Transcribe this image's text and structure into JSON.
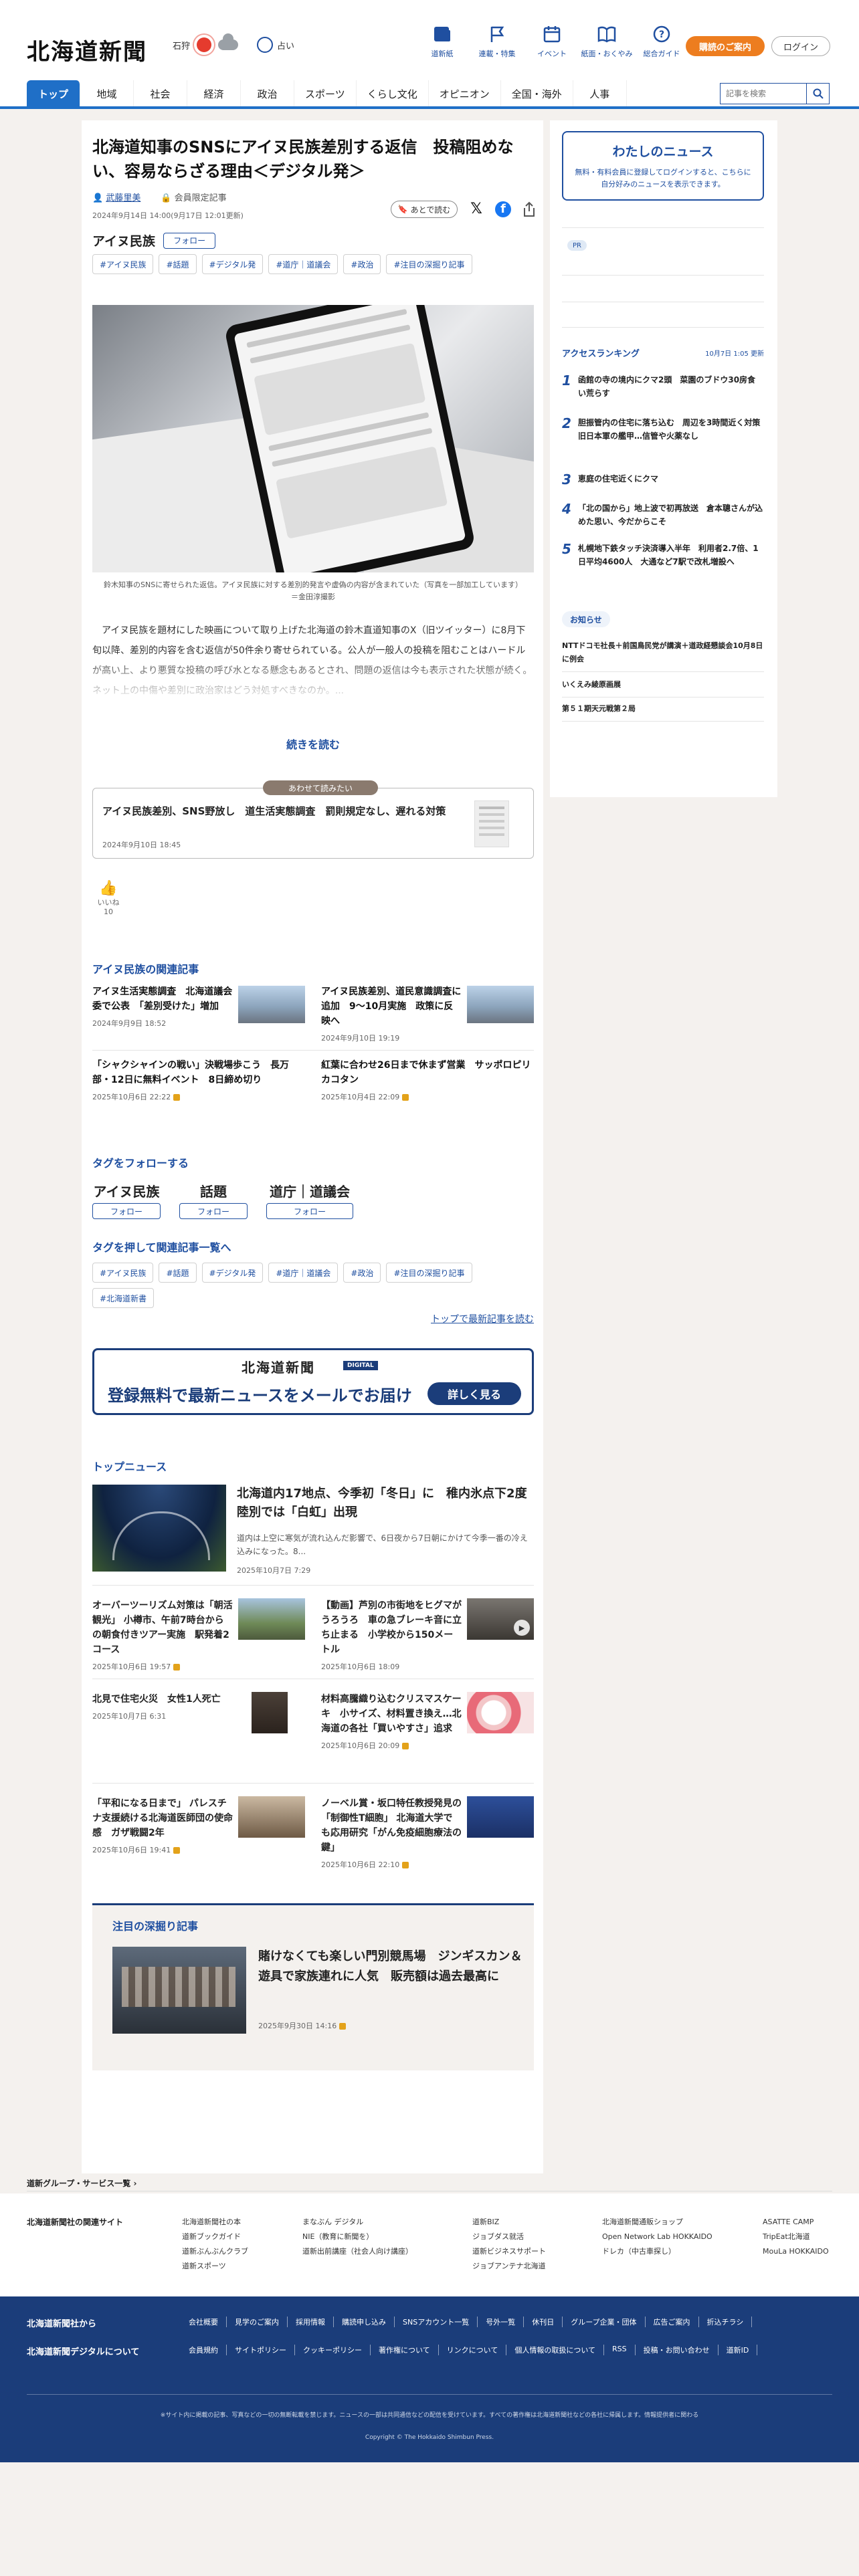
{
  "header": {
    "logo": "北海道新聞",
    "weather_city": "石狩",
    "fortune": "占い",
    "nav": [
      {
        "label": "道新紙",
        "icon": "newspaper-icon"
      },
      {
        "label": "連載・特集",
        "icon": "flag-icon"
      },
      {
        "label": "イベント",
        "icon": "calendar-icon"
      },
      {
        "label": "紙面・おくやみ",
        "icon": "book-icon"
      },
      {
        "label": "総合ガイド",
        "icon": "question-icon"
      }
    ],
    "guide_button": "購読のご案内",
    "login_button": "ログイン",
    "menu": [
      "トップ",
      "地域",
      "社会",
      "経済",
      "政治",
      "スポーツ",
      "くらし文化",
      "オピニオン",
      "全国・海外",
      "人事"
    ],
    "search_placeholder": "記事を検索"
  },
  "article": {
    "title": "北海道知事のSNSにアイヌ民族差別する返信　投稿阻めない、容易ならざる理由＜デジタル発＞",
    "author": "武藤里美",
    "member_label": "会員限定記事",
    "dates": "2024年9月14日 14:00(9月17日 12:01更新)",
    "later_button": "あとで読む",
    "topic": "アイヌ民族",
    "follow": "フォロー",
    "tags": [
      "#アイヌ民族",
      "#話題",
      "#デジタル発",
      "#道庁｜道議会",
      "#政治",
      "#注目の深掘り記事"
    ],
    "caption": "鈴木知事のSNSに寄せられた返信。アイヌ民族に対する差別的発言や虚偽の内容が含まれていた（写真を一部加工しています）＝金田淳撮影",
    "body": "アイヌ民族を題材にした映画について取り上げた北海道の鈴木直道知事のX（旧ツイッター）に8月下旬以降、差別的内容を含む返信が50件余り寄せられている。公人が一般人の投稿を阻むことはハードルが高い上、より悪質な投稿の呼び水となる懸念もあるとされ、問題の返信は今も表示された状態が続く。ネット上の中傷や差別に政治家はどう対処すべきなのか。...",
    "read_more": "続きを読む",
    "also_label": "あわせて読みたい",
    "also_title": "アイヌ民族差別、SNS野放し　道生活実態調査　罰則規定なし、遅れる対策",
    "also_date": "2024年9月10日 18:45",
    "like_label": "いいね",
    "like_count": "10"
  },
  "related": {
    "title": "アイヌ民族の関連記事",
    "items": [
      {
        "title": "アイヌ生活実態調査　北海道議会委で公表　「差別受けた」増加",
        "date": "2024年9月9日 18:52",
        "locked": false
      },
      {
        "title": "アイヌ民族差別、道民意識調査に追加　9～10月実施　政策に反映へ",
        "date": "2024年9月10日 19:19",
        "locked": false
      },
      {
        "title": "「シャクシャインの戦い」決戦場歩こう　長万部・12日に無料イベント　8日締め切り",
        "date": "2025年10月6日 22:22",
        "locked": true
      },
      {
        "title": "紅葉に合わせ26日まで休まず営業　サッポロピリカコタン",
        "date": "2025年10月4日 22:09",
        "locked": true
      }
    ]
  },
  "tag_follow": {
    "title": "タグをフォローする",
    "items": [
      "アイヌ民族",
      "話題",
      "道庁｜道議会"
    ],
    "button": "フォロー"
  },
  "tag_list": {
    "title": "タグを押して関連記事一覧へ",
    "tags": [
      "#アイヌ民族",
      "#話題",
      "#デジタル発",
      "#道庁｜道議会",
      "#政治",
      "#注目の深掘り記事",
      "#北海道新書"
    ],
    "latest_link": "トップで最新記事を読む"
  },
  "banner": {
    "logo": "北海道新聞",
    "digital": "DIGITAL",
    "text": "登録無料で最新ニュースをメールでお届け",
    "button": "詳しく見る"
  },
  "top_news": {
    "title": "トップニュース",
    "hero": {
      "title": "北海道内17地点、今季初「冬日」に　稚内氷点下2度　陸別では「白虹」出現",
      "desc": "道内は上空に寒気が流れ込んだ影響で、6日夜から7日朝にかけて今季一番の冷え込みになった。8...",
      "date": "2025年10月7日 7:29"
    },
    "items": [
      {
        "title": "オーバーツーリズム対策は「朝活観光」 小樽市、午前7時台からの朝食付きツアー実施　駅発着2コース",
        "date": "2025年10月6日 19:57",
        "locked": true
      },
      {
        "title": "【動画】芦別の市街地をヒグマがうろうろ　車の急ブレーキ音に立ち止まる　小学校から150メートル",
        "date": "2025年10月6日 18:09",
        "locked": false
      },
      {
        "title": "北見で住宅火災　女性1人死亡",
        "date": "2025年10月7日 6:31",
        "locked": false
      },
      {
        "title": "材料高騰織り込むクリスマスケーキ　小サイズ、材料置き換え…北海道の各社「買いやすさ」追求",
        "date": "2025年10月6日 20:09",
        "locked": true
      },
      {
        "title": "「平和になる日まで」 パレスチナ支援続ける北海道医師団の使命感　ガザ戦闘2年",
        "date": "2025年10月6日 19:41",
        "locked": true
      },
      {
        "title": "ノーベル賞・坂口特任教授発見の「制御性T細胞」 北海道大学でも応用研究「がん免疫細胞療法の鍵」",
        "date": "2025年10月6日 22:10",
        "locked": true
      }
    ]
  },
  "feature": {
    "title": "注目の深掘り記事",
    "headline": "賭けなくても楽しい門別競馬場　ジンギスカン＆遊具で家族連れに人気　販売額は過去最高に",
    "date": "2025年9月30日 14:16"
  },
  "sidebar": {
    "mynews_title": "わたしのニュース",
    "mynews_desc": "無料・有料会員に登録してログインすると、こちらに自分好みのニュースを表示できます。",
    "pr_label": "PR",
    "ranking_title": "アクセスランキング",
    "ranking_date": "10月7日 1:05 更新",
    "ranking": [
      "函館の寺の境内にクマ2頭　菜園のブドウ30房食い荒らす",
      "胆振管内の住宅に落ち込む　周辺を3時間近く対策　旧日本軍の艦甲…信管や火薬なし",
      "恵庭の住宅近くにクマ",
      "「北の国から」地上波で初再放送　倉本聰さんが込めた思い、今だからこそ",
      "札幌地下鉄タッチ決済導入半年　利用者2.7倍、1日平均4600人　大通など7駅で改札増設へ"
    ],
    "notice_title": "お知らせ",
    "notices": [
      "NTTドコモ社長＋前国鳥民党が講演＋道政経懇談会10月8日に例会",
      "いくえみ綾原画展",
      "第５１期天元戦第２局"
    ]
  },
  "footer": {
    "group_link": "道新グループ・サービス一覧",
    "related_sites_title": "北海道新聞社の関連サイト",
    "col1": [
      "北海道新聞社の本",
      "道新ブックガイド",
      "道新ぶんぶんクラブ",
      "道新スポーツ"
    ],
    "col2": [
      "まなぶん デジタル",
      "NIE（教育に新聞を）",
      "道新出前講座（社会人向け講座）"
    ],
    "col3": [
      "道新BIZ",
      "ジョブダス就活",
      "道新ビジネスサポート",
      "ジョブアンテナ北海道"
    ],
    "col4": [
      "北海道新聞通販ショップ",
      "Open Network Lab HOKKAIDO",
      "ドレカ（中古車探し）"
    ],
    "col5": [
      "ASATTE CAMP",
      "TripEat北海道",
      "MouLa HOKKAIDO"
    ],
    "about_title": "北海道新聞社から",
    "digital_title": "北海道新聞デジタルについて",
    "about_links": [
      "会社概要",
      "見学のご案内",
      "採用情報",
      "購読申し込み",
      "SNSアカウント一覧",
      "号外一覧",
      "休刊日",
      "グループ企業・団体",
      "広告ご案内",
      "折込チラシ"
    ],
    "digital_links": [
      "会員規約",
      "サイトポリシー",
      "クッキーポリシー",
      "著作権について",
      "リンクについて",
      "個人情報の取扱について",
      "RSS",
      "投稿・お問い合わせ",
      "道新ID"
    ],
    "note": "※サイト内に掲載の記事、写真などの一切の無断転載を禁じます。ニュースの一部は共同通信などの配信を受けています。すべての著作権は北海道新聞社などの各社に帰属します。情報提供者に関わる",
    "copyright": "Copyright © The Hokkaido Shimbun Press."
  },
  "colors": {
    "brand": "#1b3d7a",
    "accent": "#1f6fc7",
    "orange": "#ed7d1f"
  }
}
